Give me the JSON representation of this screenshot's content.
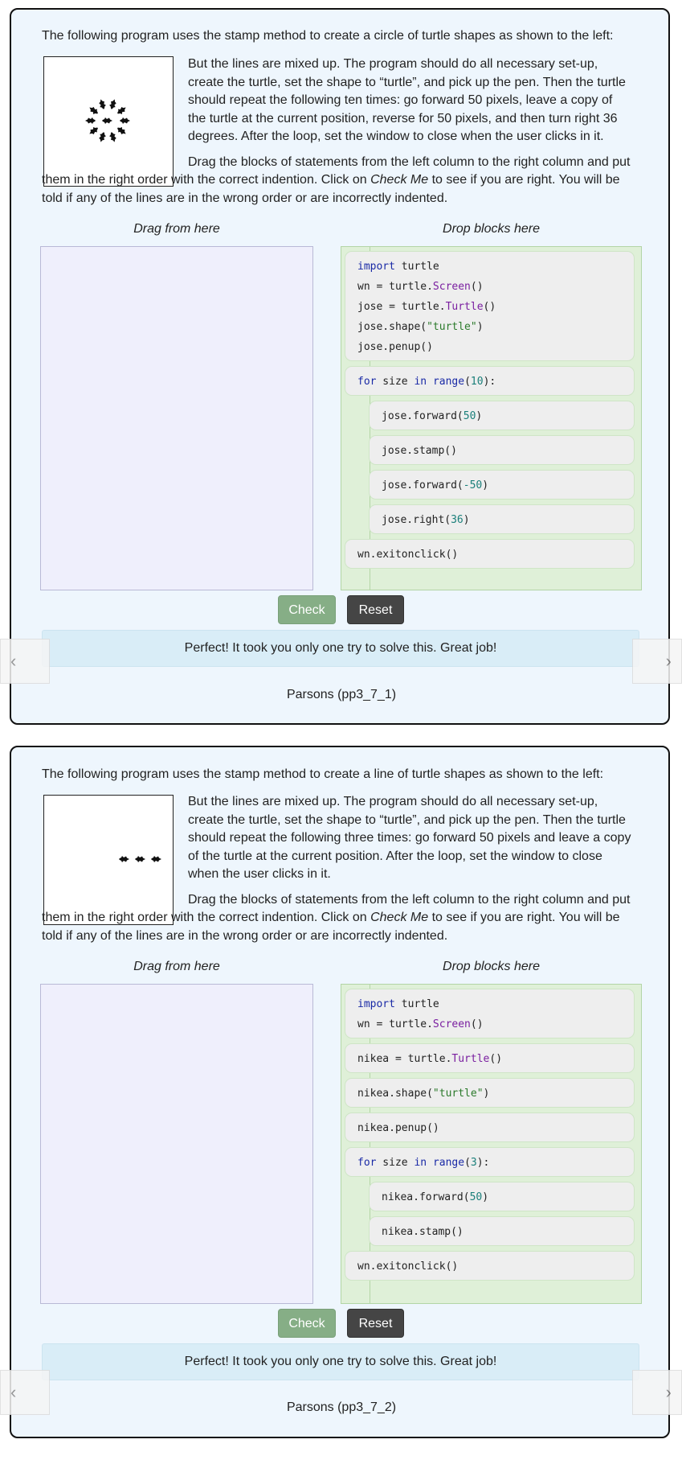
{
  "problems": [
    {
      "prompt": "The following program uses the stamp method to create a circle of turtle shapes as shown to the left:",
      "paragraph1": "But the lines are mixed up. The program should do all necessary set-up, create the turtle, set the shape to “turtle”, and pick up the pen. Then the turtle should repeat the following ten times: go forward 50 pixels, leave a copy of the turtle at the current position, reverse for 50 pixels, and then turn right 36 degrees. After the loop, set the window to close when the user clicks in it.",
      "paragraph2_before": "Drag the blocks of statements from the left column to the right column and put them in the right order with the correct indention. Click on ",
      "paragraph2_emph": "Check Me",
      "paragraph2_after": " to see if you are right. You will be told if any of the lines are in the wrong order or are incorrectly indented.",
      "drag_label": "Drag from here",
      "drop_label": "Drop blocks here",
      "check_label": "Check",
      "reset_label": "Reset",
      "feedback": "Perfect! It took you only one try to solve this. Great job!",
      "caption": "Parsons (pp3_7_1)",
      "blocks": [
        {
          "indent": 0,
          "lines": [
            "import turtle",
            "wn = turtle.Screen()",
            "jose = turtle.Turtle()",
            "jose.shape(\"turtle\")",
            "jose.penup()"
          ]
        },
        {
          "indent": 0,
          "lines": [
            "for size in range(10):"
          ]
        },
        {
          "indent": 1,
          "lines": [
            "jose.forward(50)"
          ]
        },
        {
          "indent": 1,
          "lines": [
            "jose.stamp()"
          ]
        },
        {
          "indent": 1,
          "lines": [
            "jose.forward(-50)"
          ]
        },
        {
          "indent": 1,
          "lines": [
            "jose.right(36)"
          ]
        },
        {
          "indent": 0,
          "lines": [
            "wn.exitonclick()"
          ]
        }
      ]
    },
    {
      "prompt": "The following program uses the stamp method to create a line of turtle shapes as shown to the left:",
      "paragraph1": "But the lines are mixed up. The program should do all necessary set-up, create the turtle, set the shape to “turtle”, and pick up the pen. Then the turtle should repeat the following three times: go forward 50 pixels and leave a copy of the turtle at the current position. After the loop, set the window to close when the user clicks in it.",
      "paragraph2_before": "Drag the blocks of statements from the left column to the right column and put them in the right order with the correct indention. Click on ",
      "paragraph2_emph": "Check Me",
      "paragraph2_after": " to see if you are right. You will be told if any of the lines are in the wrong order or are incorrectly indented.",
      "drag_label": "Drag from here",
      "drop_label": "Drop blocks here",
      "check_label": "Check",
      "reset_label": "Reset",
      "feedback": "Perfect! It took you only one try to solve this. Great job!",
      "caption": "Parsons (pp3_7_2)",
      "blocks": [
        {
          "indent": 0,
          "lines": [
            "import turtle",
            "wn = turtle.Screen()"
          ]
        },
        {
          "indent": 0,
          "lines": [
            "nikea = turtle.Turtle()"
          ]
        },
        {
          "indent": 0,
          "lines": [
            "nikea.shape(\"turtle\")"
          ]
        },
        {
          "indent": 0,
          "lines": [
            "nikea.penup()"
          ]
        },
        {
          "indent": 0,
          "lines": [
            "for size in range(3):"
          ]
        },
        {
          "indent": 1,
          "lines": [
            "nikea.forward(50)"
          ]
        },
        {
          "indent": 1,
          "lines": [
            "nikea.stamp()"
          ]
        },
        {
          "indent": 0,
          "lines": [
            "wn.exitonclick()"
          ]
        }
      ]
    }
  ],
  "nav": {
    "prev_icon": "‹",
    "next_icon": "›"
  }
}
